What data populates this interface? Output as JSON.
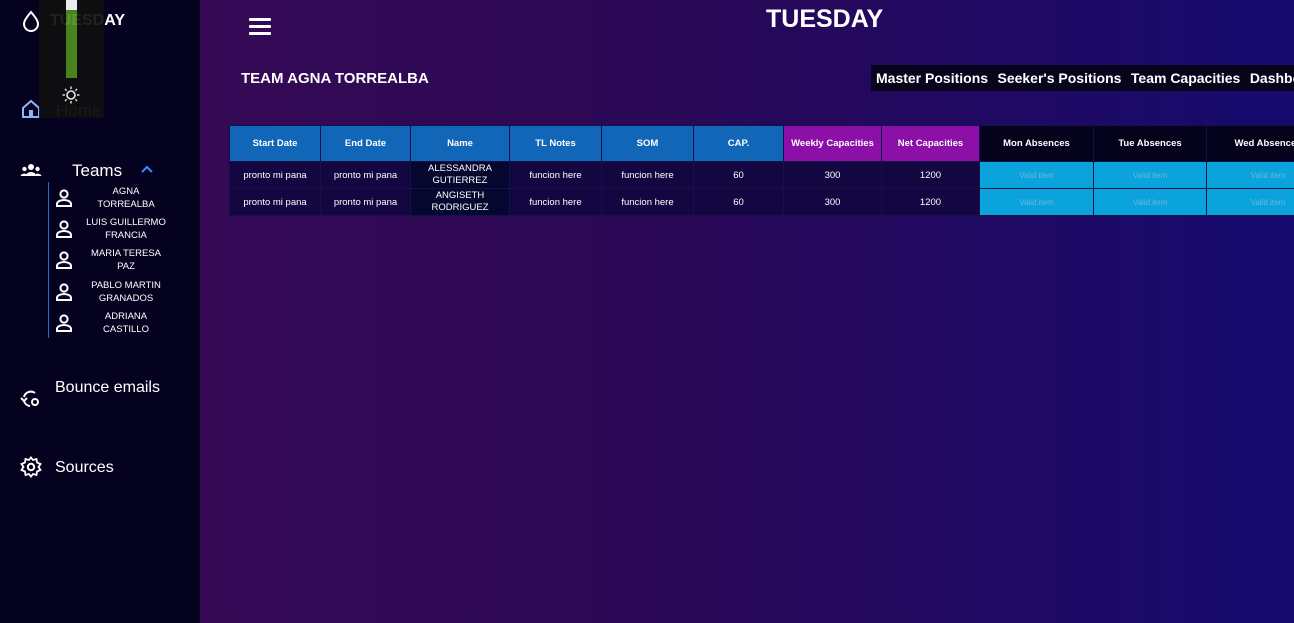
{
  "app": {
    "logo_text": "TUESDAY"
  },
  "sidebar": {
    "home_label": "Home",
    "teams_label": "Teams",
    "members": [
      "AGNA TORREALBA",
      "LUIS GUILLERMO FRANCIA",
      "MARIA TERESA PAZ",
      "PABLO MARTIN GRANADOS",
      "ADRIANA CASTILLO"
    ],
    "bounce_label": "Bounce emails",
    "sources_label": "Sources"
  },
  "header": {
    "title": "TUESDAY"
  },
  "team": {
    "title": "TEAM AGNA TORREALBA"
  },
  "topnav": [
    "Master Positions",
    "Seeker's Positions",
    "Team Capacities",
    "Dashboard"
  ],
  "table": {
    "headers": [
      "Start Date",
      "End Date",
      "Name",
      "TL Notes",
      "SOM",
      "CAP.",
      "Weekly Capacities",
      "Net Capacities",
      "Mon Absences",
      "Tue Absences",
      "Wed Absences"
    ],
    "rows": [
      {
        "start": "pronto mi pana",
        "end": "pronto mi pana",
        "name": "ALESSANDRA GUTIERREZ",
        "tl_notes": "funcion here",
        "som": "funcion here",
        "cap": "60",
        "weekly": "300",
        "net": "1200",
        "mon": "Valid item",
        "tue": "Valid item",
        "wed": "Valid item"
      },
      {
        "start": "pronto mi pana",
        "end": "pronto mi pana",
        "name": "ANGISETH RODRIGUEZ",
        "tl_notes": "funcion here",
        "som": "funcion here",
        "cap": "60",
        "weekly": "300",
        "net": "1200",
        "mon": "Valid item",
        "tue": "Valid item",
        "wed": "Valid item"
      }
    ]
  },
  "colors": {
    "header_blue": "#1266b8",
    "header_purple": "#8c10a8",
    "absence_cyan": "#0aa3dc",
    "sidebar_bg": "#05021f"
  }
}
